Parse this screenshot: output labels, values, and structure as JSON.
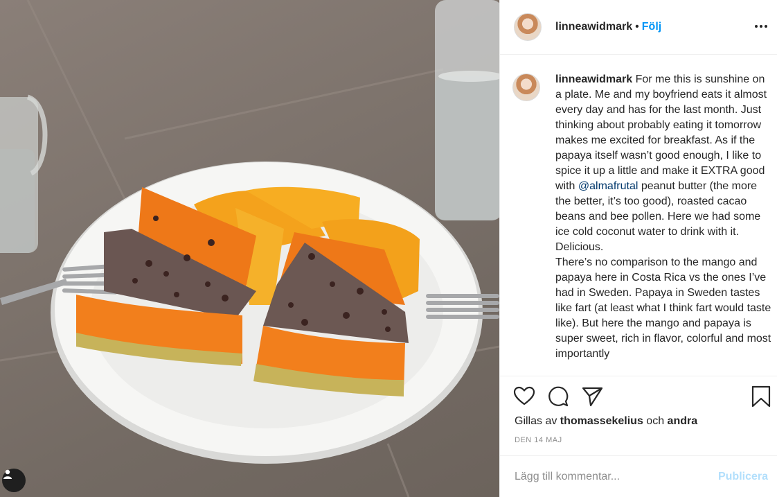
{
  "post": {
    "username": "linneawidmark",
    "dot": "•",
    "follow_label": "Följ",
    "caption": {
      "username": "linneawidmark",
      "text_before_mention": " For me this is sunshine on a plate. Me and my boyfriend eats it almost every day and has for the last month. Just thinking about probably eating it tomorrow makes me excited for breakfast. As if the papaya itself wasn’t good enough, I like to spice it up a little and make it EXTRA good with ",
      "mention": "@almafrutal",
      "text_after_mention": " peanut butter (the more the better, it’s too good), roasted cacao beans and bee pollen. Here we had some ice cold coconut water to drink with it. Delicious.\nThere’s no comparison to the mango and papaya here in Costa Rica vs the ones I’ve had in Sweden. Papaya in Sweden tastes like fart (at least what I think fart would taste like). But here the mango and papaya is super sweet, rich in flavor, colorful and most importantly"
    },
    "likes": {
      "prefix": "Gillas av ",
      "liker": "thomassekelius",
      "middle": " och ",
      "others": "andra"
    },
    "date": "DEN 14 MAJ",
    "comment": {
      "placeholder": "Lägg till kommentar...",
      "publish_label": "Publicera"
    }
  },
  "icons": {
    "more": "more-options-icon",
    "like": "heart-icon",
    "comment": "comment-icon",
    "share": "paper-plane-icon",
    "save": "bookmark-icon",
    "photo_tag": "user-tag-icon"
  },
  "colors": {
    "link_blue": "#0095f6",
    "publish_disabled": "#b2dffc",
    "secondary_text": "#8e8e8e",
    "mention": "#00376b"
  }
}
